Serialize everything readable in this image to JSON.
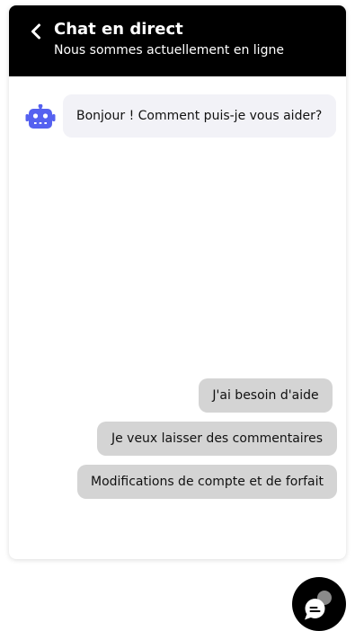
{
  "header": {
    "title": "Chat en direct",
    "subtitle": "Nous sommes actuellement en ligne",
    "back_icon": "chevron-left-icon"
  },
  "messages": [
    {
      "sender": "bot",
      "avatar_icon": "robot-icon",
      "text": "Bonjour ! Comment puis-je vous aider?"
    }
  ],
  "quick_replies": [
    {
      "label": "J'ai besoin d'aide"
    },
    {
      "label": "Je veux laisser des commentaires"
    },
    {
      "label": "Modifications de compte et de forfait"
    }
  ],
  "launcher": {
    "icon": "chat-bubbles-icon"
  },
  "colors": {
    "header_bg": "#000000",
    "bot_bubble_bg": "#f2f2f7",
    "reply_bg": "#d4d4d4",
    "bot_icon": "#5561f0"
  }
}
